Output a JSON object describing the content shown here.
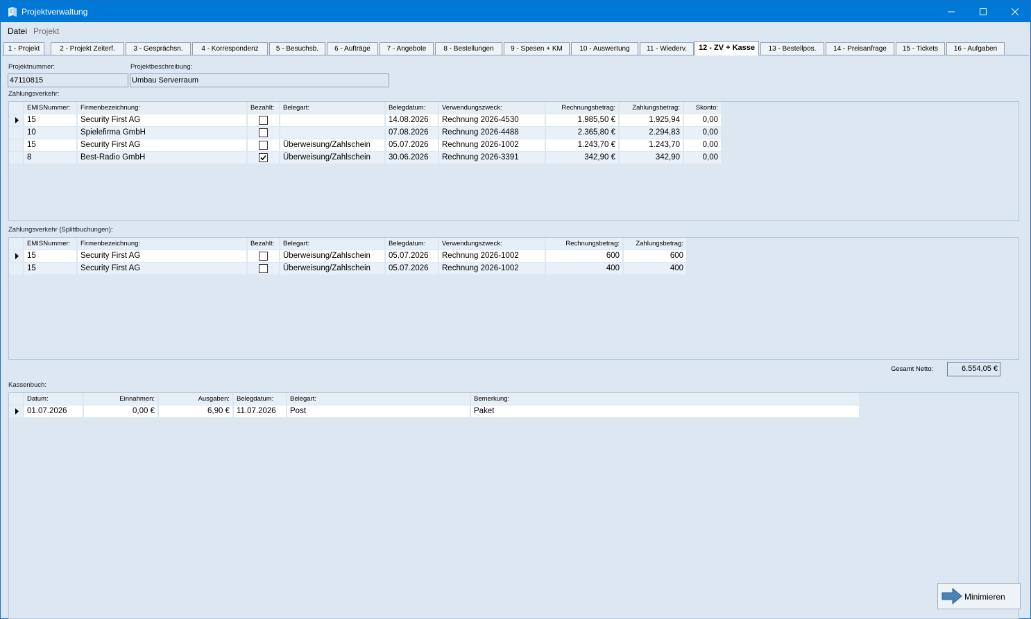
{
  "window": {
    "title": "Projektverwaltung"
  },
  "menu": {
    "datei": "Datei",
    "projekt": "Projekt"
  },
  "tabs": [
    {
      "label": "1 - Projekt"
    },
    {
      "label": "2 - Projekt Zeiterf."
    },
    {
      "label": "3 - Gesprächsn."
    },
    {
      "label": "4 - Korrespondenz"
    },
    {
      "label": "5 - Besuchsb."
    },
    {
      "label": "6 - Aufträge"
    },
    {
      "label": "7 - Angebote"
    },
    {
      "label": "8 - Bestellungen"
    },
    {
      "label": "9 - Spesen + KM"
    },
    {
      "label": "10 - Auswertung"
    },
    {
      "label": "11 - Wiederv."
    },
    {
      "label": "12 - ZV + Kasse"
    },
    {
      "label": "13 - Bestellpos."
    },
    {
      "label": "14 - Preisanfrage"
    },
    {
      "label": "15 - Tickets"
    },
    {
      "label": "16 - Aufgaben"
    }
  ],
  "active_tab": "12 - ZV + Kasse",
  "project": {
    "nummer_label": "Projektnummer:",
    "nummer_value": "47110815",
    "beschreibung_label": "Projektbeschreibung:",
    "beschreibung_value": "Umbau Serverraum"
  },
  "zahlungsverkehr": {
    "title": "Zahlungsverkehr:",
    "headers": [
      "EMISNummer:",
      "Firmenbezeichnung:",
      "Bezahlt:",
      "Belegart:",
      "Belegdatum:",
      "Verwendungszweck:",
      "Rechnungsbetrag:",
      "Zahlungsbetrag:",
      "Skonto:"
    ],
    "rows": [
      {
        "emis": "15",
        "firma": "Security First AG",
        "bezahlt": false,
        "belegart": "",
        "datum": "14.08.2026",
        "zweck": "Rechnung 2026-4530",
        "rechnung": "1.985,50 €",
        "zahlung": "1.925,94",
        "skonto": "0,00",
        "current": true
      },
      {
        "emis": "10",
        "firma": "Spielefirma GmbH",
        "bezahlt": false,
        "belegart": "",
        "datum": "07.08.2026",
        "zweck": "Rechnung 2026-4488",
        "rechnung": "2.365,80 €",
        "zahlung": "2.294,83",
        "skonto": "0,00",
        "current": false
      },
      {
        "emis": "15",
        "firma": "Security First AG",
        "bezahlt": false,
        "belegart": "Überweisung/Zahlschein",
        "datum": "05.07.2026",
        "zweck": "Rechnung 2026-1002",
        "rechnung": "1.243,70 €",
        "zahlung": "1.243,70",
        "skonto": "0,00",
        "current": false
      },
      {
        "emis": "8",
        "firma": "Best-Radio GmbH",
        "bezahlt": true,
        "belegart": "Überweisung/Zahlschein",
        "datum": "30.06.2026",
        "zweck": "Rechnung 2026-3391",
        "rechnung": "342,90 €",
        "zahlung": "342,90",
        "skonto": "0,00",
        "current": false
      }
    ]
  },
  "splittbuchungen": {
    "title": "Zahlungsverkehr (Splittbuchungen):",
    "headers": [
      "EMISNummer:",
      "Firmenbezeichnung:",
      "Bezahlt:",
      "Belegart:",
      "Belegdatum:",
      "Verwendungszweck:",
      "Rechnungsbetrag:",
      "Zahlungsbetrag:"
    ],
    "rows": [
      {
        "emis": "15",
        "firma": "Security First AG",
        "bezahlt": false,
        "belegart": "Überweisung/Zahlschein",
        "datum": "05.07.2026",
        "zweck": "Rechnung 2026-1002",
        "rechnung": "600",
        "zahlung": "600",
        "current": true
      },
      {
        "emis": "15",
        "firma": "Security First AG",
        "bezahlt": false,
        "belegart": "Überweisung/Zahlschein",
        "datum": "05.07.2026",
        "zweck": "Rechnung 2026-1002",
        "rechnung": "400",
        "zahlung": "400",
        "current": false
      }
    ]
  },
  "gesamt": {
    "label": "Gesamt Netto:",
    "value": "6.554,05 €"
  },
  "kassenbuch": {
    "title": "Kassenbuch:",
    "headers": [
      "Datum:",
      "Einnahmen:",
      "Ausgaben:",
      "Belegdatum:",
      "Belegart:",
      "Bemerkung:"
    ],
    "rows": [
      {
        "datum": "01.07.2026",
        "einnahmen": "0,00 €",
        "ausgaben": "6,90 €",
        "belegdatum": "11.07.2026",
        "belegart": "Post",
        "bemerkung": "Paket",
        "current": true
      }
    ]
  },
  "buttons": {
    "minimieren": "Minimieren"
  },
  "colors": {
    "titlebar": "#0078d7",
    "background": "#dce7f2",
    "arrow": "#4a82b8"
  }
}
